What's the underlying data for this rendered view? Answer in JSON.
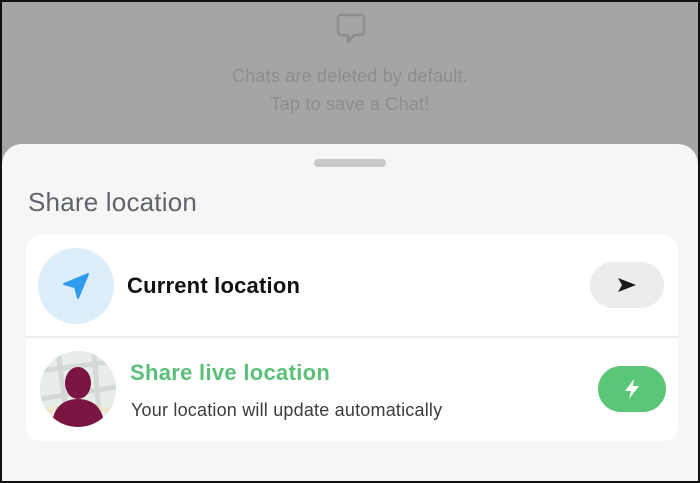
{
  "chat": {
    "icon": "chat-bubble-icon",
    "line1": "Chats are deleted by default.",
    "line2": "Tap to save a Chat!"
  },
  "sheet": {
    "title": "Share location",
    "current": {
      "icon": "location-arrow-icon",
      "label": "Current location",
      "action_icon": "send-arrow-icon"
    },
    "live": {
      "icon": "avatar-map-icon",
      "label": "Share live location",
      "subtitle": "Your location will update automatically",
      "action_icon": "lightning-bolt-icon"
    }
  },
  "colors": {
    "accent_green": "#5ac677",
    "live_text_green": "#5cbf79",
    "location_blue": "#2f9bef",
    "avatar_maroon": "#7a1542"
  }
}
